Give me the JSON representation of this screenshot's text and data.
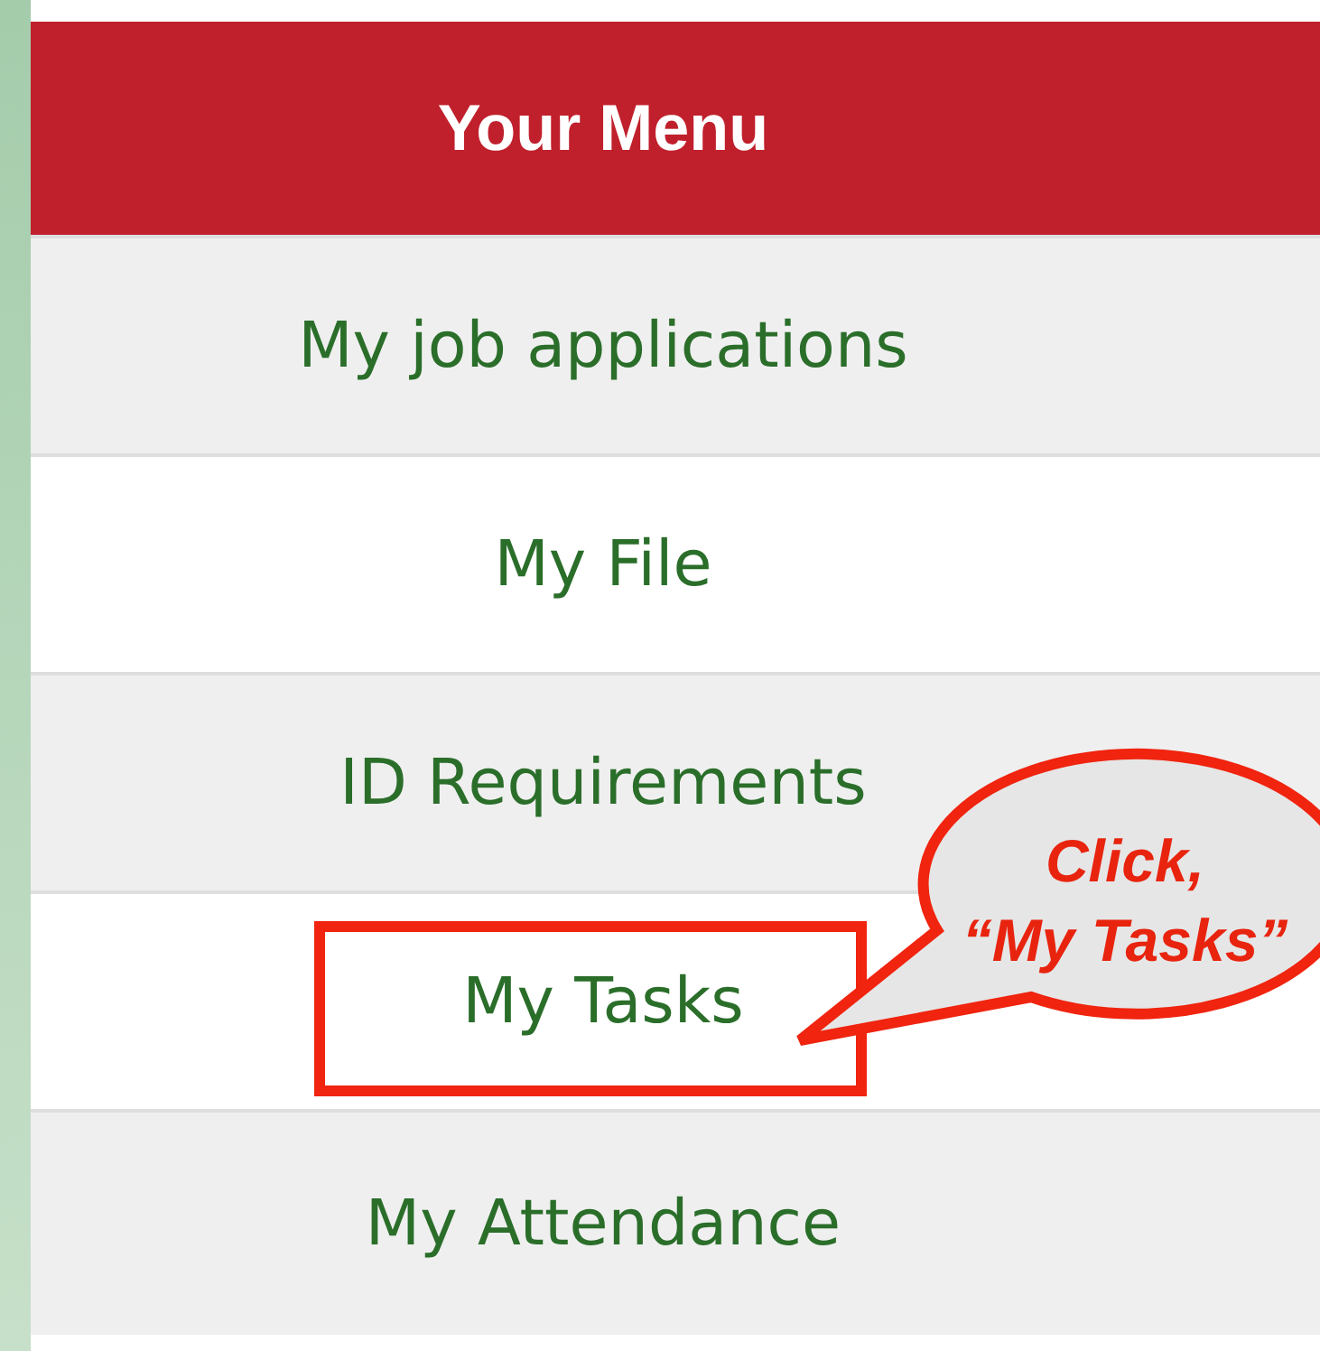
{
  "header": {
    "title": "Your Menu"
  },
  "menu_items": [
    {
      "label": "My job applications",
      "highlighted": false
    },
    {
      "label": "My File",
      "highlighted": false
    },
    {
      "label": "ID Requirements",
      "highlighted": false
    },
    {
      "label": "My Tasks",
      "highlighted": true
    },
    {
      "label": "My Attendance",
      "highlighted": false
    }
  ],
  "callout": {
    "lines": [
      "Click,",
      "“My Tasks”"
    ]
  }
}
